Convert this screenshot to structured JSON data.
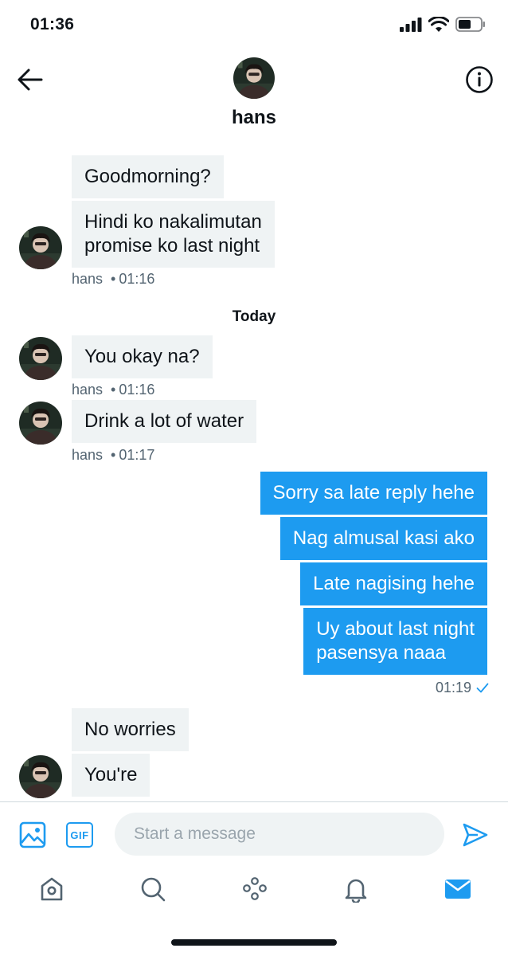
{
  "status_bar": {
    "time": "01:36"
  },
  "header": {
    "contact_name": "hans"
  },
  "conversation": {
    "incoming_1": {
      "messages": [
        "Goodmorning?",
        "Hindi ko nakalimutan\npromise ko last night"
      ],
      "sender": "hans",
      "time": "01:16"
    },
    "day_separator": "Today",
    "incoming_2": {
      "message": "You okay na?",
      "sender": "hans",
      "time": "01:16"
    },
    "incoming_3": {
      "message": "Drink a lot of water",
      "sender": "hans",
      "time": "01:17"
    },
    "outgoing": {
      "messages": [
        "Sorry sa late reply hehe",
        "Nag almusal kasi ako",
        "Late nagising hehe",
        "Uy about last night\npasensya naaa"
      ],
      "time": "01:19"
    },
    "incoming_4": {
      "messages": [
        "No worries",
        "You're"
      ]
    }
  },
  "composer": {
    "placeholder": "Start a message",
    "gif_label": "GIF"
  },
  "colors": {
    "accent": "#1d9bf0",
    "incoming_bubble": "#eff3f4",
    "meta_text": "#536471"
  },
  "icons": {
    "back": "arrow-left-icon",
    "info": "info-icon",
    "media": "image-icon",
    "gif": "gif-icon",
    "send": "send-icon",
    "tabs": [
      "home-icon",
      "search-icon",
      "spaces-icon",
      "bell-icon",
      "mail-icon"
    ]
  }
}
